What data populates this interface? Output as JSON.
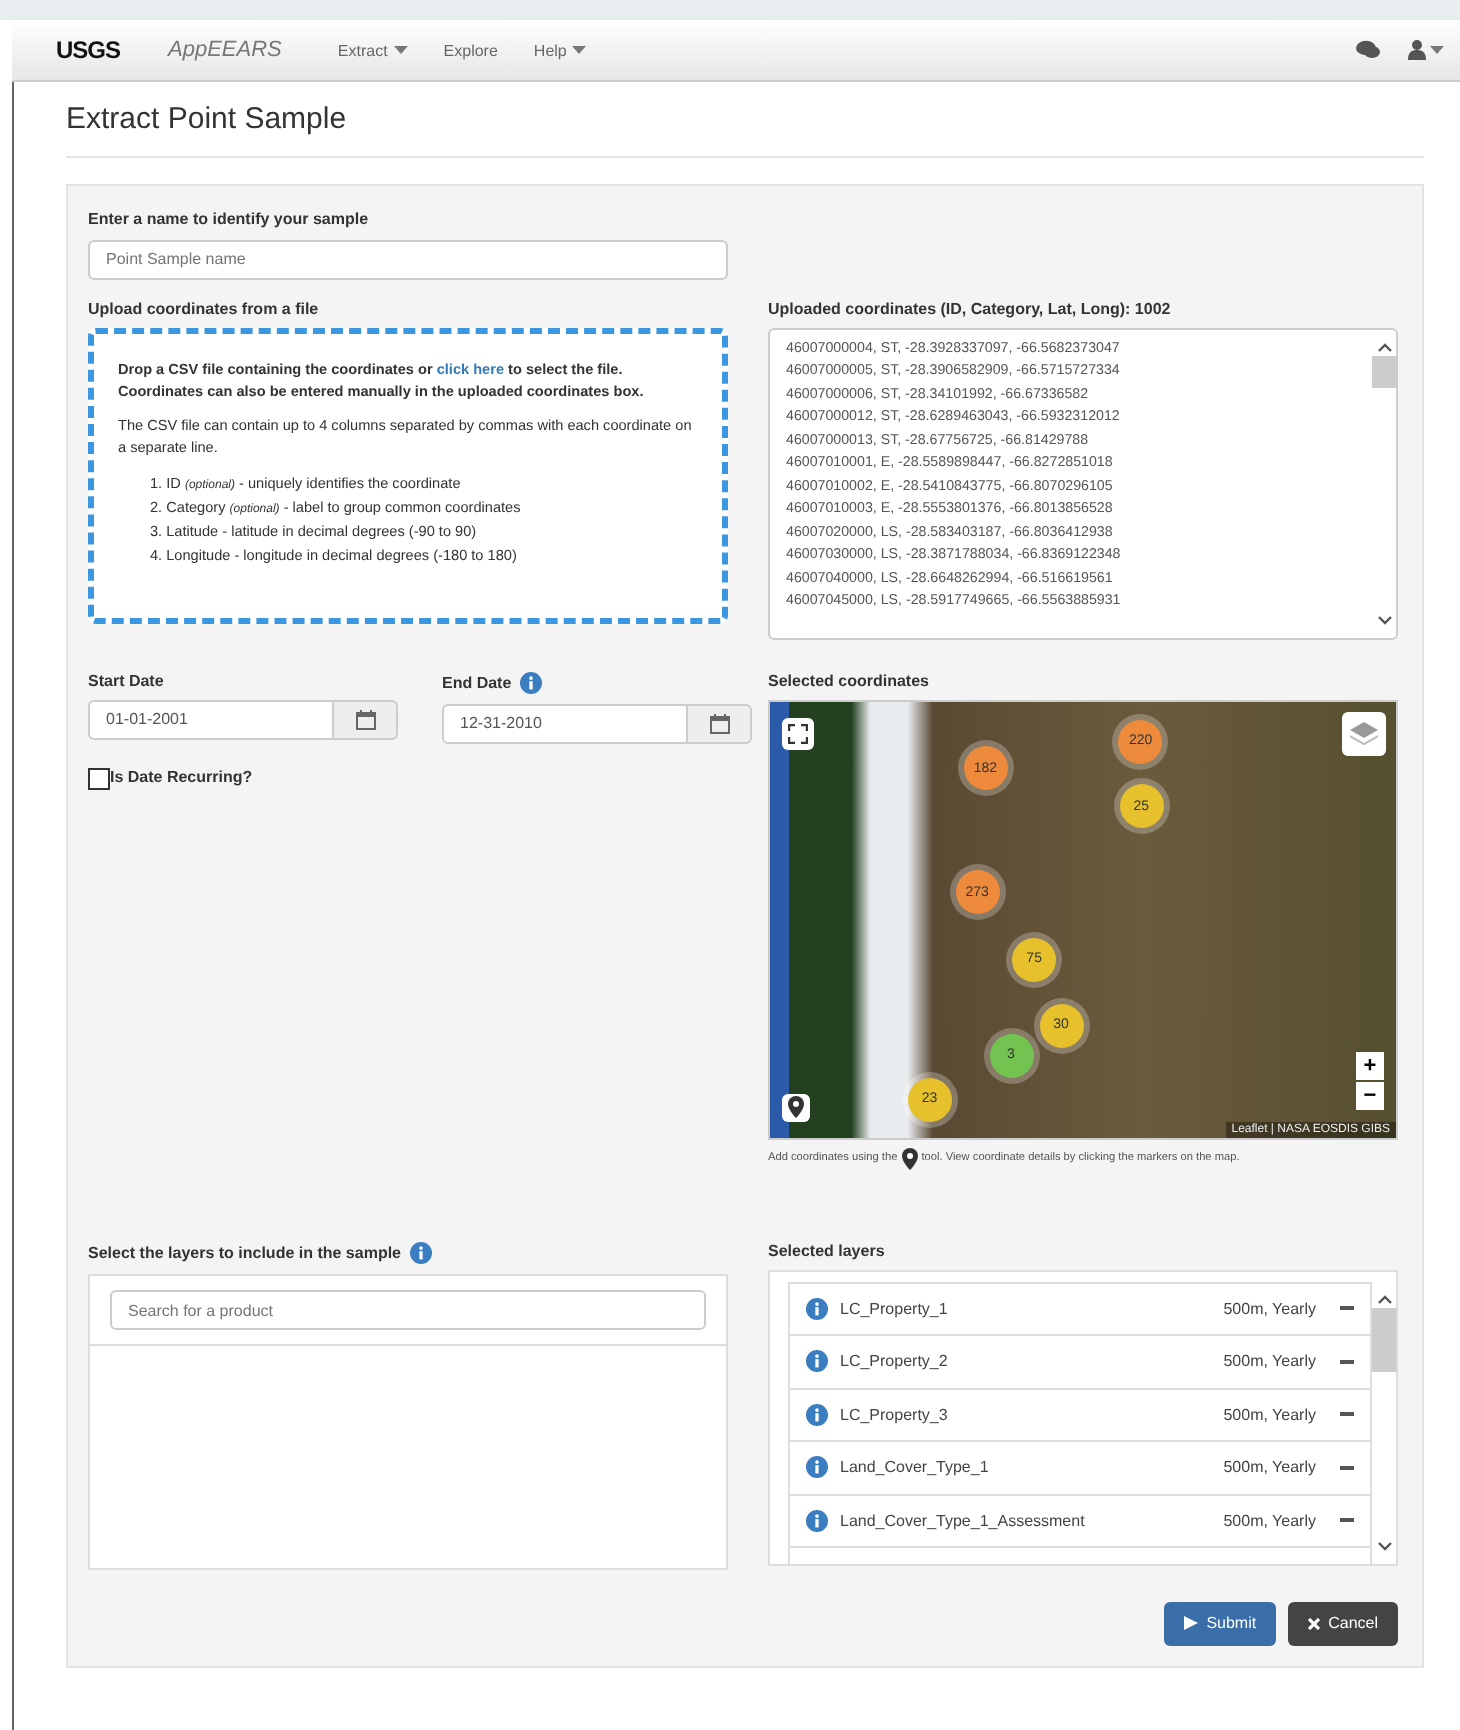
{
  "navbar": {
    "logo": "USGS",
    "app_name": "AppEEARS",
    "menu": [
      {
        "label": "Extract",
        "dropdown": true
      },
      {
        "label": "Explore",
        "dropdown": false
      },
      {
        "label": "Help",
        "dropdown": true
      }
    ]
  },
  "page_title": "Extract Point Sample",
  "sample_name": {
    "label": "Enter a name to identify your sample",
    "placeholder": "Point Sample name"
  },
  "upload": {
    "label": "Upload coordinates from a file",
    "intro_before": "Drop a CSV file containing the coordinates or",
    "link": "click here",
    "intro_after": "to select the file. Coordinates can also be entered manually in the uploaded coordinates box.",
    "note": "The CSV file can contain up to 4 columns separated by commas with each coordinate on a separate line.",
    "columns": [
      {
        "number": "1.",
        "name": "ID",
        "tag": "(optional)",
        "desc": "- uniquely identifies the coordinate"
      },
      {
        "number": "2.",
        "name": "Category",
        "tag": "(optional)",
        "desc": "- label to group common coordinates"
      },
      {
        "number": "3.",
        "name": "Latitude",
        "desc": "- latitude in decimal degrees (-90 to 90)"
      },
      {
        "number": "4.",
        "name": "Longitude",
        "desc": "- longitude in decimal degrees (-180 to 180)"
      }
    ]
  },
  "uploaded": {
    "label": "Uploaded coordinates (ID, Category, Lat, Long): 1002",
    "lines": [
      "46007000004, ST, -28.3928337097, -66.5682373047",
      "46007000005, ST, -28.3906582909, -66.5715727334",
      "46007000006, ST, -28.34101992, -66.67336582",
      "46007000012, ST, -28.6289463043, -66.5932312012",
      "46007000013, ST, -28.67756725, -66.81429788",
      "46007010001, E, -28.5589898447, -66.8272851018",
      "46007010002, E, -28.5410843775, -66.8070296105",
      "46007010003, E, -28.5553801376, -66.8013856528",
      "46007020000, LS, -28.583403187, -66.8036412938",
      "46007030000, LS, -28.3871788034, -66.8369122348",
      "46007040000, LS, -28.6648262994, -66.516619561",
      "46007045000, LS, -28.5917749665, -66.5563885931"
    ]
  },
  "start_date": {
    "label": "Start Date",
    "value": "01-01-2001"
  },
  "end_date": {
    "label": "End Date",
    "value": "12-31-2010",
    "info": true
  },
  "recurring": {
    "label": "Is Date Recurring?",
    "checked": false
  },
  "map": {
    "label": "Selected coordinates",
    "attribution": "Leaflet | NASA EOSDIS GIBS",
    "zoom_in": "+",
    "zoom_out": "−",
    "caption_before": "Add coordinates using the",
    "caption_after": "tool. View coordinate details by clicking the markers on the map.",
    "clusters": [
      {
        "count": "182",
        "color": "#ee8a3c"
      },
      {
        "count": "220",
        "color": "#ee8a3c"
      },
      {
        "count": "25",
        "color": "#e6c12c"
      },
      {
        "count": "273",
        "color": "#ee8a3c"
      },
      {
        "count": "75",
        "color": "#e6c12c"
      },
      {
        "count": "30",
        "color": "#e6c12c"
      },
      {
        "count": "3",
        "color": "#72c350"
      },
      {
        "count": "23",
        "color": "#e6c12c"
      }
    ]
  },
  "layers_search": {
    "label": "Select the layers to include in the sample",
    "placeholder": "Search for a product"
  },
  "selected_layers": {
    "label": "Selected layers",
    "items": [
      {
        "name": "LC_Property_1",
        "detail": "500m, Yearly"
      },
      {
        "name": "LC_Property_2",
        "detail": "500m, Yearly"
      },
      {
        "name": "LC_Property_3",
        "detail": "500m, Yearly"
      },
      {
        "name": "Land_Cover_Type_1",
        "detail": "500m, Yearly"
      },
      {
        "name": "Land_Cover_Type_1_Assessment",
        "detail": "500m, Yearly"
      }
    ]
  },
  "buttons": [
    {
      "label": "Submit",
      "kind": "primary"
    },
    {
      "label": "Cancel",
      "kind": "secondary"
    }
  ]
}
